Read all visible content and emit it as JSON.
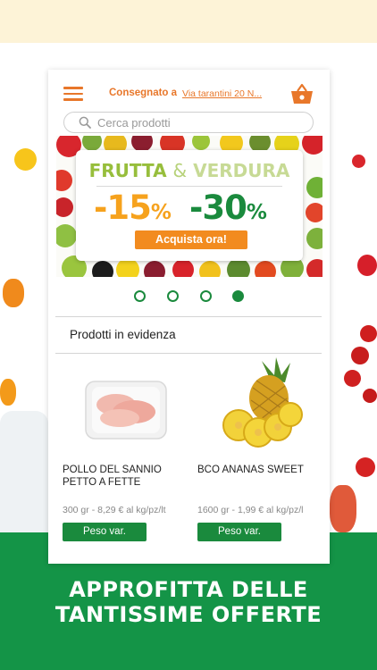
{
  "header": {
    "delivery_label": "Consegnato a",
    "delivery_address": "Via tarantini 20 N..."
  },
  "search": {
    "placeholder": "Cerca prodotti"
  },
  "banner": {
    "title_part1": "FRUTTA",
    "title_amp": "&",
    "title_part2": "VERDURA",
    "discount_1": "-15",
    "discount_2": "-30",
    "percent": "%",
    "cta_label": "Acquista ora!",
    "slide_count": 4,
    "active_slide": 4
  },
  "featured": {
    "section_title": "Prodotti in evidenza",
    "products": [
      {
        "name_line1": "POLLO DEL SANNIO",
        "name_line2": "PETTO A FETTE",
        "price": "300 gr - 8,29 € al kg/pz/lt",
        "button_label": "Peso var."
      },
      {
        "name_line1": "BCO ANANAS SWEET",
        "name_line2": "",
        "price": "1600 gr - 1,99 € al kg/pz/l",
        "button_label": "Peso var."
      }
    ]
  },
  "promo": {
    "line1": "APPROFITTA DELLE",
    "line2": "TANTISSIME OFFERTE"
  },
  "colors": {
    "accent_orange": "#e8772a",
    "brand_green": "#1a8a3d",
    "bottom_band": "#149447",
    "top_band": "#fdf3d7"
  },
  "icons": {
    "menu": "hamburger-menu-icon",
    "cart": "basket-icon",
    "search": "search-icon"
  }
}
